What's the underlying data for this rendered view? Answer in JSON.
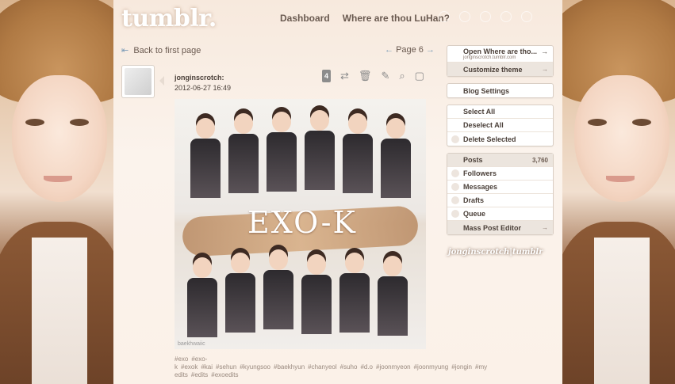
{
  "header": {
    "logo": "tumblr.",
    "nav": [
      "Dashboard",
      "Where are thou LuHan?"
    ]
  },
  "pager": {
    "back": "Back to first page",
    "page": "Page 6"
  },
  "post": {
    "username": "jonginscrotch:",
    "timestamp": "2012-06-27 16:49",
    "reblog_count": "4",
    "image_title": "EXO-K",
    "watermark": "baekhwaiic",
    "tags": [
      "#exo",
      "#exo-k",
      "#exok",
      "#kai",
      "#sehun",
      "#kyungsoo",
      "#baekhyun",
      "#chanyeol",
      "#suho",
      "#d.o",
      "#joonmyeon",
      "#joonmyung",
      "#jongin",
      "#my edits",
      "#edits",
      "#exoedits"
    ]
  },
  "sidebar": {
    "blog": {
      "open_label": "Open Where are tho...",
      "url": "jonginscrotch.tumblr.com",
      "customize": "Customize theme"
    },
    "settings": "Blog Settings",
    "selection": [
      "Select All",
      "Deselect All",
      "Delete Selected"
    ],
    "stats": [
      {
        "label": "Posts",
        "count": "3,760"
      },
      {
        "label": "Followers",
        "count": ""
      },
      {
        "label": "Messages",
        "count": ""
      },
      {
        "label": "Drafts",
        "count": ""
      },
      {
        "label": "Queue",
        "count": ""
      },
      {
        "label": "Mass Post Editor",
        "count": ""
      }
    ],
    "blog_label": "jonginscrotch|tumblr"
  },
  "colors": {
    "accent": "#7a9bb7",
    "text": "#4a3f38"
  }
}
